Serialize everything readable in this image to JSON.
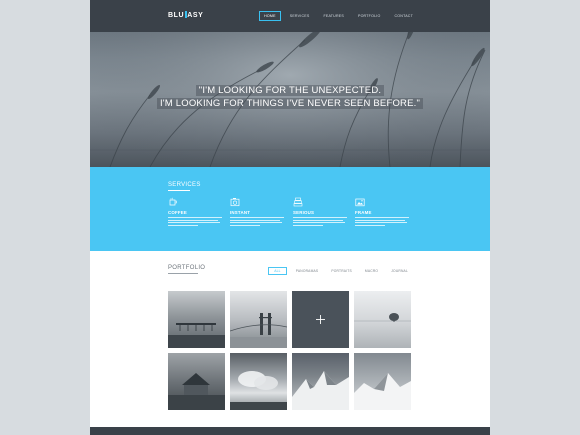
{
  "brand": {
    "logo_left": "BLU",
    "logo_right": "ASY"
  },
  "nav": {
    "items": [
      "HOME",
      "SERVICES",
      "FEATURES",
      "PORTFOLIO",
      "CONTACT"
    ],
    "active_index": 0
  },
  "hero": {
    "quote_line1": "\"I'M LOOKING FOR THE UNEXPECTED.",
    "quote_line2": "I'M LOOKING FOR THINGS I'VE NEVER SEEN BEFORE.\""
  },
  "services": {
    "title": "SERVICES",
    "items": [
      {
        "name": "COFFEE",
        "icon": "coffee-cup-icon"
      },
      {
        "name": "INSTANT",
        "icon": "camera-icon"
      },
      {
        "name": "SERIOUS",
        "icon": "stack-icon"
      },
      {
        "name": "FRAME",
        "icon": "picture-frame-icon"
      }
    ]
  },
  "portfolio": {
    "title": "PORTFOLIO",
    "filters": [
      "ALL",
      "PANORAMAS",
      "PORTRAITS",
      "MACRO",
      "JOURNAL"
    ],
    "active_filter_index": 0,
    "thumbnails": [
      {
        "name": "pier",
        "shade": "#8c9196"
      },
      {
        "name": "bridge",
        "shade": "#b5babe"
      },
      {
        "name": "hover-plus",
        "shade": "#4a525a"
      },
      {
        "name": "lake-tree",
        "shade": "#d4d7da"
      },
      {
        "name": "barn",
        "shade": "#6d7378"
      },
      {
        "name": "clouds",
        "shade": "#a3a9ae"
      },
      {
        "name": "mountains",
        "shade": "#5f666c"
      },
      {
        "name": "snow-peaks",
        "shade": "#9ea4a9"
      }
    ]
  },
  "colors": {
    "accent": "#4ac6f3",
    "dark": "#3a4149",
    "background": "#d7dce0"
  }
}
